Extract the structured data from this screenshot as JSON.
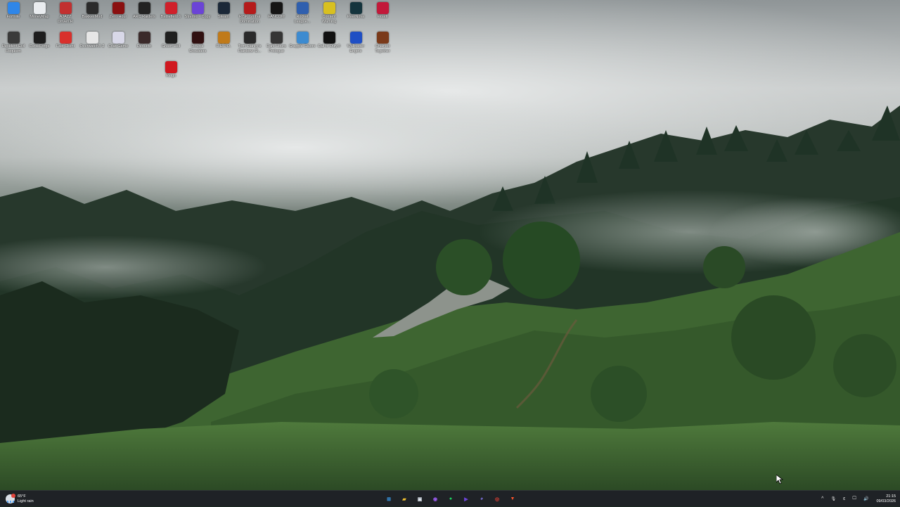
{
  "desktop": {
    "icons": [
      {
        "label": "Fortnite",
        "icon": "fortnite-icon",
        "color": "#2f86e8"
      },
      {
        "label": "MoneyMap",
        "icon": "moneymap-icon",
        "color": "#e9ecef"
      },
      {
        "label": "AJAZZ Driven.R",
        "icon": "ajazz-icon",
        "color": "#c23030"
      },
      {
        "label": "BakkesMod",
        "icon": "bakkesmod-icon",
        "color": "#2b2b2b"
      },
      {
        "label": "Zero Hour",
        "icon": "zero-hour-icon",
        "color": "#8a1010"
      },
      {
        "label": "ARC Raiders",
        "icon": "arc-raiders-icon",
        "color": "#222222"
      },
      {
        "label": "Battlefield 6",
        "icon": "battlefield-icon",
        "color": "#d0202a"
      },
      {
        "label": "Stremio - Copy",
        "icon": "stremio-icon",
        "color": "#6b44d6"
      },
      {
        "label": "Steam",
        "icon": "steam-icon",
        "color": "#1b2838"
      },
      {
        "label": "RISK Global Domination",
        "icon": "risk-icon",
        "color": "#b51b1b"
      },
      {
        "label": "FANCOM",
        "icon": "fancom-icon",
        "color": "#151515"
      },
      {
        "label": "Rocket League...",
        "icon": "rocket-league-icon",
        "color": "#2f5fae"
      },
      {
        "label": "Content Warning",
        "icon": "content-warning-icon",
        "color": "#d8c020"
      },
      {
        "label": "PeerNova",
        "icon": "peernova-icon",
        "color": "#14343d"
      },
      {
        "label": "Floatlt",
        "icon": "floatlt-icon",
        "color": "#c2193a"
      },
      {
        "label": "Resident Evil Requiem",
        "icon": "resident-evil-icon",
        "color": "#3a3a3a"
      },
      {
        "label": "CurseForge",
        "icon": "curseforge-icon",
        "color": "#1e1e1e"
      },
      {
        "label": "Fast Client",
        "icon": "fast-client-icon",
        "color": "#d9302c"
      },
      {
        "label": "Overwatch® 2",
        "icon": "overwatch-icon",
        "color": "#e6e6e6"
      },
      {
        "label": "Crab Game",
        "icon": "crab-game-icon",
        "color": "#d8d8e8"
      },
      {
        "label": "Deducto",
        "icon": "deducto-icon",
        "color": "#3b2a2a"
      },
      {
        "label": "Green Hell",
        "icon": "green-hell-icon",
        "color": "#1f1f1f"
      },
      {
        "label": "Double Shoulders",
        "icon": "double-shoulders-icon",
        "color": "#301010"
      },
      {
        "label": "R.E.P.O.",
        "icon": "repo-icon",
        "color": "#c07a1a"
      },
      {
        "label": "Tom Clancy's Rainbow Si...",
        "icon": "rainbow-six-icon",
        "color": "#2a2a2a"
      },
      {
        "label": "Dark Hours Prologue",
        "icon": "dark-hours-icon",
        "color": "#353535"
      },
      {
        "label": "Grapple Galore",
        "icon": "grapple-galore-icon",
        "color": "#3d8bd0"
      },
      {
        "label": "Call of Duty®",
        "icon": "call-of-duty-icon",
        "color": "#111111"
      },
      {
        "label": "Wallpaper Engine",
        "icon": "wallpaper-engine-icon",
        "color": "#1f4fc4"
      },
      {
        "label": "Chained Together",
        "icon": "chained-together-icon",
        "color": "#7a3a1a"
      },
      {
        "label": "Reign",
        "icon": "reign-icon",
        "color": "#d0181f"
      }
    ]
  },
  "taskbar": {
    "weather": {
      "temp": "65°F",
      "condition": "Light rain"
    },
    "apps": [
      {
        "name": "start-button",
        "glyph": "⊞",
        "color": "#3aa0f0"
      },
      {
        "name": "file-explorer-icon",
        "glyph": "▰",
        "color": "#f2c230"
      },
      {
        "name": "microsoft-store-icon",
        "glyph": "▣",
        "color": "#dfe6ee"
      },
      {
        "name": "messenger-icon",
        "glyph": "◉",
        "color": "#9b5cf0"
      },
      {
        "name": "spotify-icon",
        "glyph": "●",
        "color": "#1ed760"
      },
      {
        "name": "stremio-icon",
        "glyph": "▶",
        "color": "#6b44d6"
      },
      {
        "name": "discord-icon",
        "glyph": "◕",
        "color": "#8a7cf8"
      },
      {
        "name": "chrome-icon",
        "glyph": "◎",
        "color": "#e94235"
      },
      {
        "name": "brave-icon",
        "glyph": "▼",
        "color": "#fb542b"
      }
    ],
    "tray": {
      "chevron": "^",
      "mic": "🎙",
      "lang": "ε",
      "network": "🖵",
      "volume": "🔊",
      "time": "21:15",
      "date": "09/03/2026"
    }
  }
}
